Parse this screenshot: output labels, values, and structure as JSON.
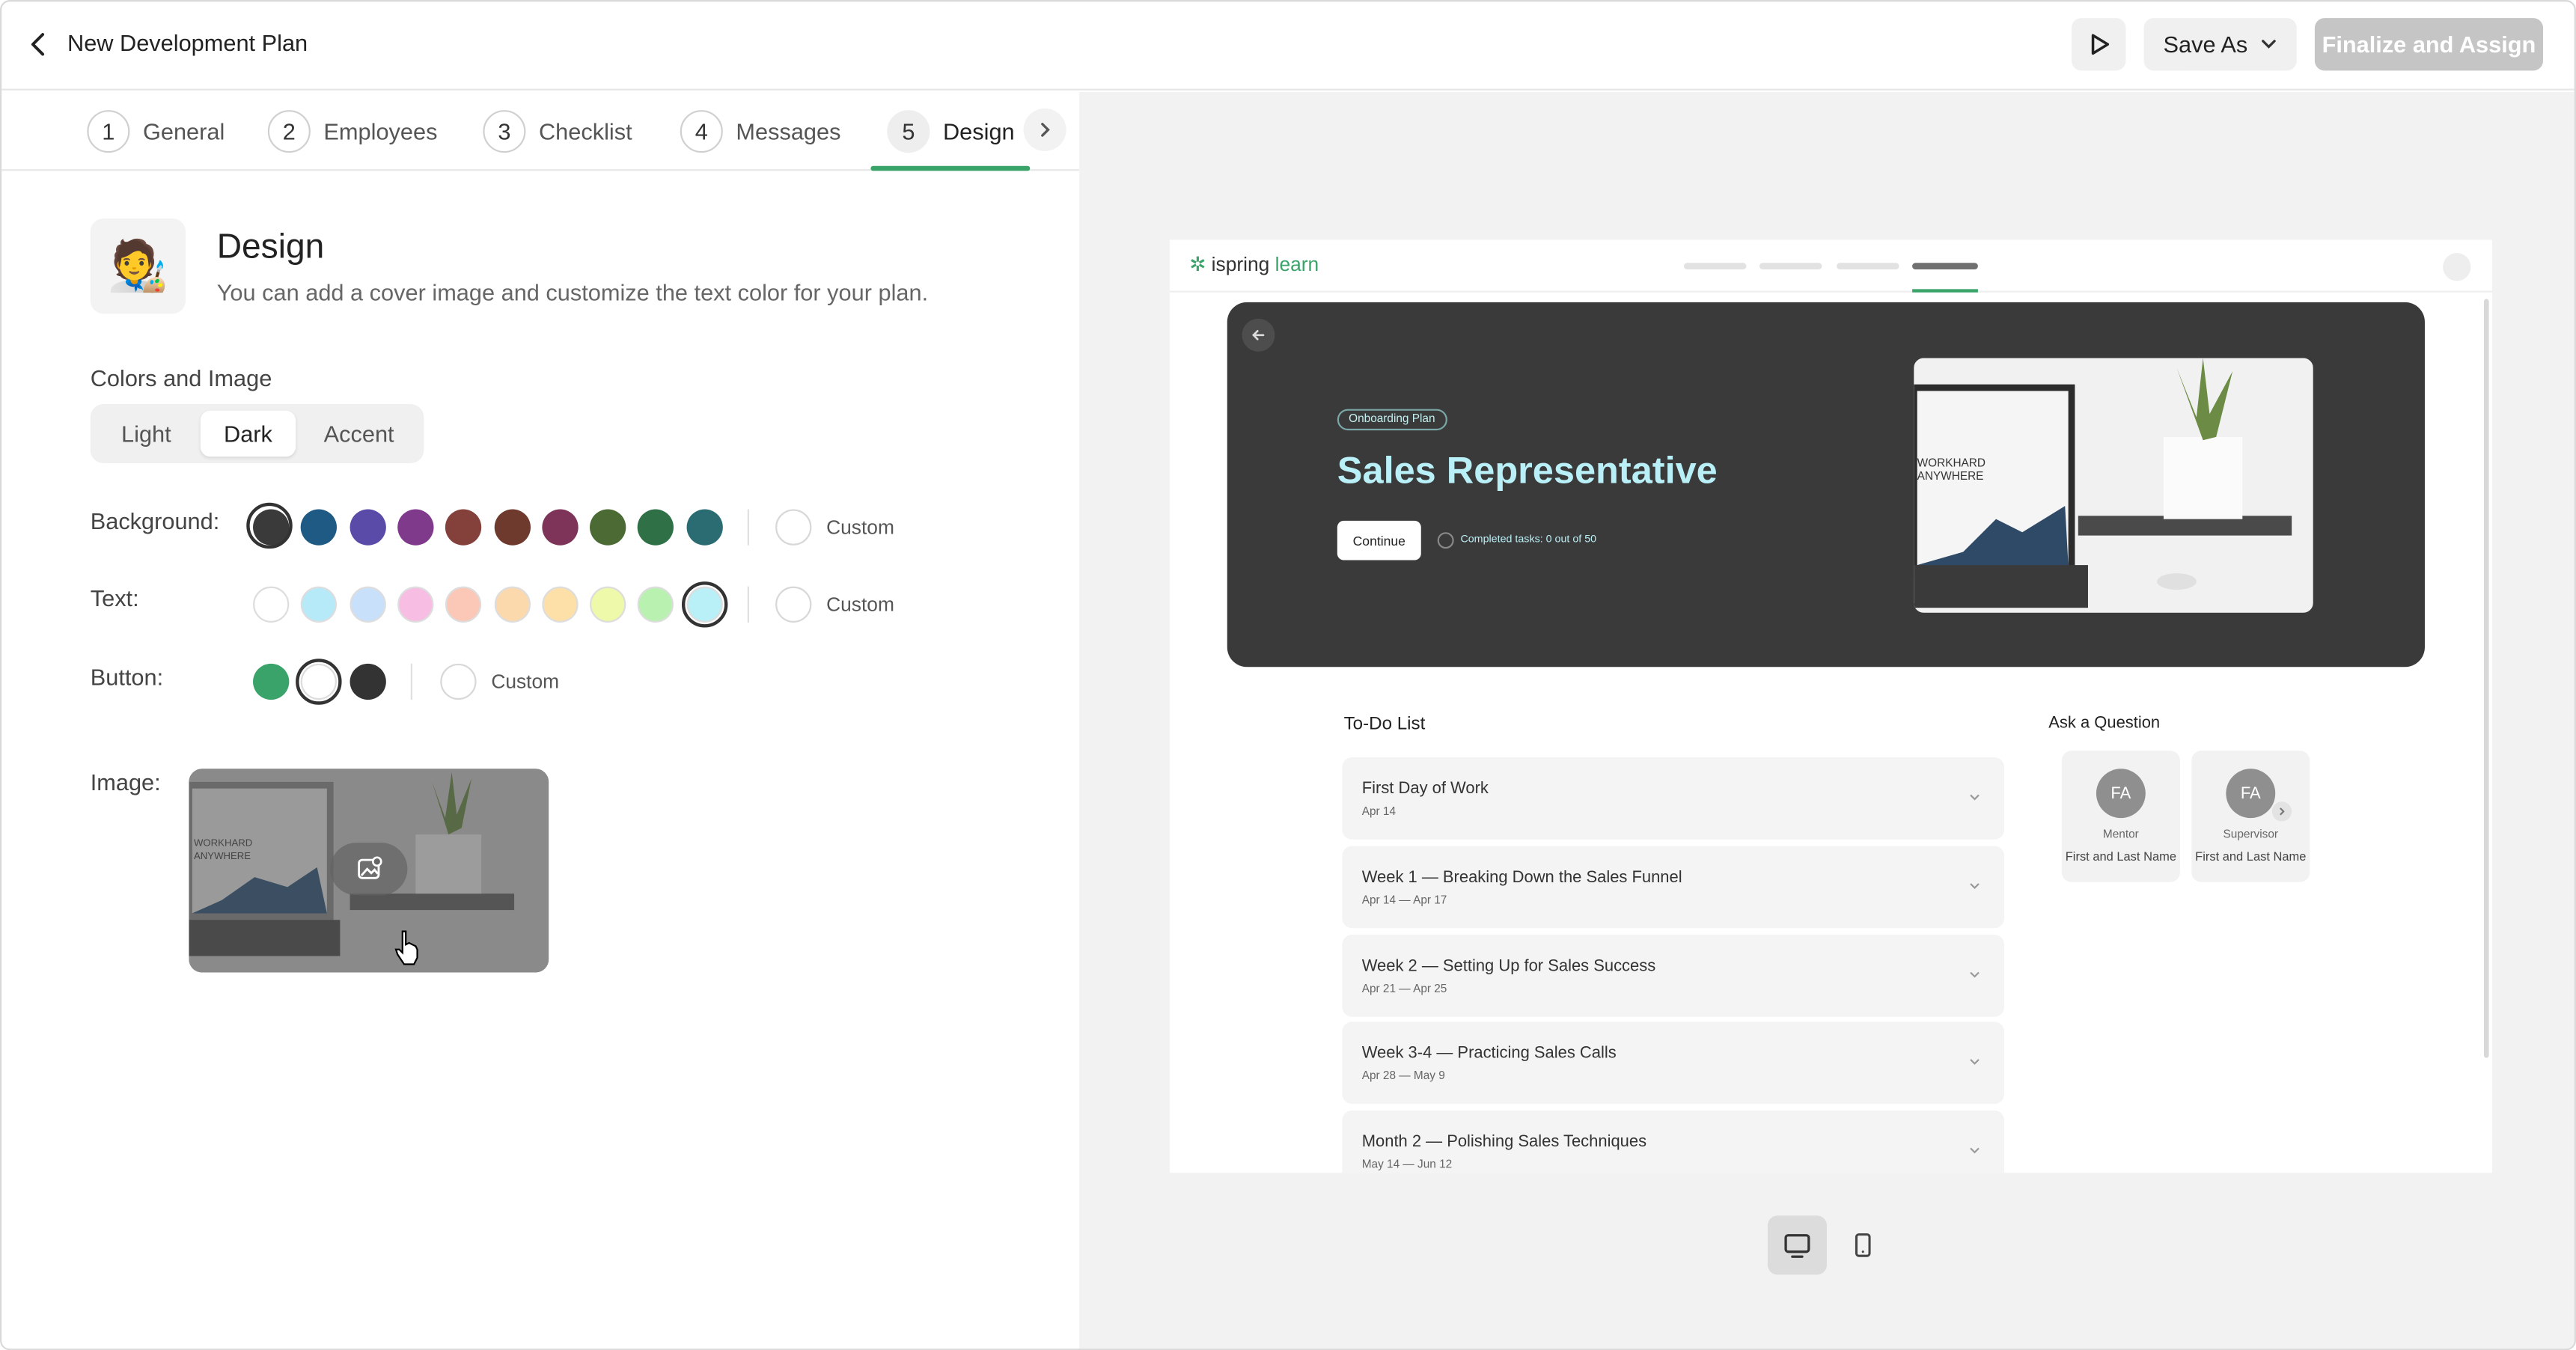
{
  "header": {
    "title": "New Development Plan",
    "save_as_label": "Save As",
    "finalize_label": "Finalize and Assign"
  },
  "steps": [
    {
      "num": "1",
      "label": "General"
    },
    {
      "num": "2",
      "label": "Employees"
    },
    {
      "num": "3",
      "label": "Checklist"
    },
    {
      "num": "4",
      "label": "Messages"
    },
    {
      "num": "5",
      "label": "Design"
    }
  ],
  "design": {
    "emoji": "🧑‍🎨",
    "title": "Design",
    "subtitle": "You can add a cover image and customize the text color for your plan.",
    "section_label": "Colors and Image",
    "theme_options": [
      "Light",
      "Dark",
      "Accent"
    ],
    "theme_selected": "Dark",
    "background_label": "Background:",
    "text_label": "Text:",
    "button_label": "Button:",
    "custom_label": "Custom",
    "image_label": "Image:",
    "background_colors": [
      "#3a3a3a",
      "#1f5a84",
      "#5a4ba8",
      "#7f3a8c",
      "#84403a",
      "#6f3a2e",
      "#7e3358",
      "#4c6a34",
      "#2f7047",
      "#2a6c72"
    ],
    "background_selected": 0,
    "text_colors": [
      "#ffffff",
      "#b7eaf8",
      "#c9e0fb",
      "#f7bde3",
      "#fbc7b7",
      "#fcd9ac",
      "#fde0a7",
      "#eef9a9",
      "#b9f2b0",
      "#b9eff6"
    ],
    "text_selected": 9,
    "button_colors": [
      "#3aa36a",
      "#ffffff",
      "#333333"
    ],
    "button_selected": 1
  },
  "preview": {
    "logo_prefix": "ispring",
    "logo_suffix": "learn",
    "badge": "Onboarding Plan",
    "title": "Sales Representative",
    "continue_label": "Continue",
    "progress_text": "Completed tasks: 0 out of 50",
    "image_caption": "WORKHARD ANYWHERE",
    "todo_title": "To-Do List",
    "todo_items": [
      {
        "title": "First Day of Work",
        "date": "Apr 14"
      },
      {
        "title": "Week 1 — Breaking Down the Sales Funnel",
        "date": "Apr 14 — Apr 17"
      },
      {
        "title": "Week 2 — Setting Up for Sales Success",
        "date": "Apr 21 — Apr 25"
      },
      {
        "title": "Week 3-4 — Practicing Sales Calls",
        "date": "Apr 28 — May 9"
      },
      {
        "title": "Month 2 — Polishing Sales Techniques",
        "date": "May 14 — Jun 12"
      }
    ],
    "ask_title": "Ask a Question",
    "people": [
      {
        "initials": "FA",
        "role": "Mentor",
        "name": "First and Last Name"
      },
      {
        "initials": "FA",
        "role": "Supervisor",
        "name": "First and Last Name"
      }
    ]
  },
  "icons": {
    "back": "chevron-left-icon",
    "play": "play-icon",
    "dropdown": "chevron-down-icon",
    "tabs_next": "chevron-right-icon",
    "image_edit": "image-edit-icon",
    "desktop": "desktop-icon",
    "mobile": "mobile-icon"
  }
}
